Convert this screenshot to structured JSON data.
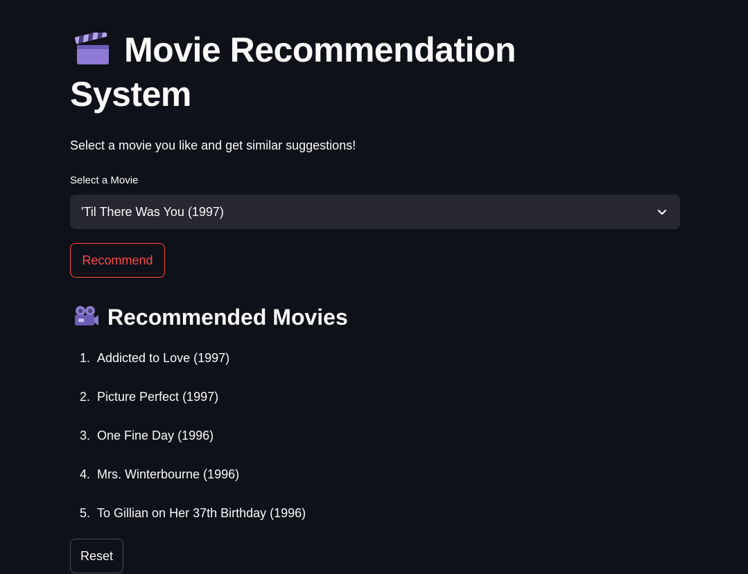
{
  "page": {
    "title": "Movie Recommendation System",
    "title_icon": "clapper-board-icon",
    "subtitle": "Select a movie you like and get similar suggestions!"
  },
  "movie_select": {
    "label": "Select a Movie",
    "selected_value": "'Til There Was You (1997)",
    "icon": "chevron-down-icon"
  },
  "buttons": {
    "recommend_label": "Recommend",
    "reset_label": "Reset"
  },
  "recommendations": {
    "heading": "Recommended Movies",
    "heading_icon": "movie-camera-icon",
    "items": [
      {
        "number": "1.",
        "title": "Addicted to Love (1997)"
      },
      {
        "number": "2.",
        "title": "Picture Perfect (1997)"
      },
      {
        "number": "3.",
        "title": "One Fine Day (1996)"
      },
      {
        "number": "4.",
        "title": "Mrs. Winterbourne (1996)"
      },
      {
        "number": "5.",
        "title": "To Gillian on Her 37th Birthday (1996)"
      }
    ]
  },
  "colors": {
    "background": "#0e1117",
    "text": "#fafafa",
    "accent": "#ff4b4b",
    "input_background": "#262730"
  }
}
